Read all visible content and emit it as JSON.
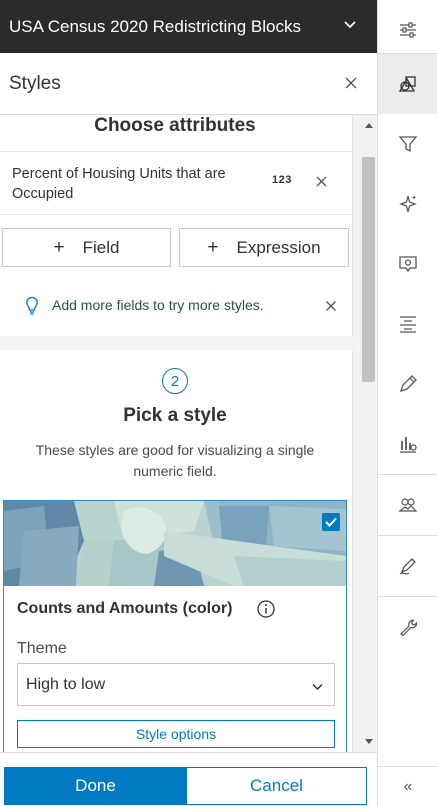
{
  "header": {
    "title": "USA Census 2020 Redistricting Blocks"
  },
  "panel": {
    "title": "Styles"
  },
  "attributes": {
    "title": "Choose attributes",
    "field_name": "Percent of Housing Units that are Occupied",
    "field_type_badge": "123",
    "add_field_label": "Field",
    "add_expression_label": "Expression",
    "tip": "Add more fields to try more styles."
  },
  "style": {
    "step": "2",
    "title": "Pick a style",
    "description": "These styles are good for visualizing a single numeric field.",
    "card_title": "Counts and Amounts (color)",
    "theme_label": "Theme",
    "theme_value": "High to low",
    "style_options_label": "Style options"
  },
  "footer": {
    "done_label": "Done",
    "cancel_label": "Cancel"
  },
  "rail": {
    "items": [
      "sliders-icon",
      "styles-icon",
      "filter-icon",
      "effects-icon",
      "popup-icon",
      "labels-icon",
      "edit-icon",
      "charts-icon",
      "clustering-icon",
      "sketch-icon",
      "wrench-icon"
    ],
    "collapse_icon": "chevrons-left-icon"
  },
  "colors": {
    "accent": "#007ac2",
    "header_bg": "#2b2b2b",
    "tip_text": "#1f5c2e"
  }
}
